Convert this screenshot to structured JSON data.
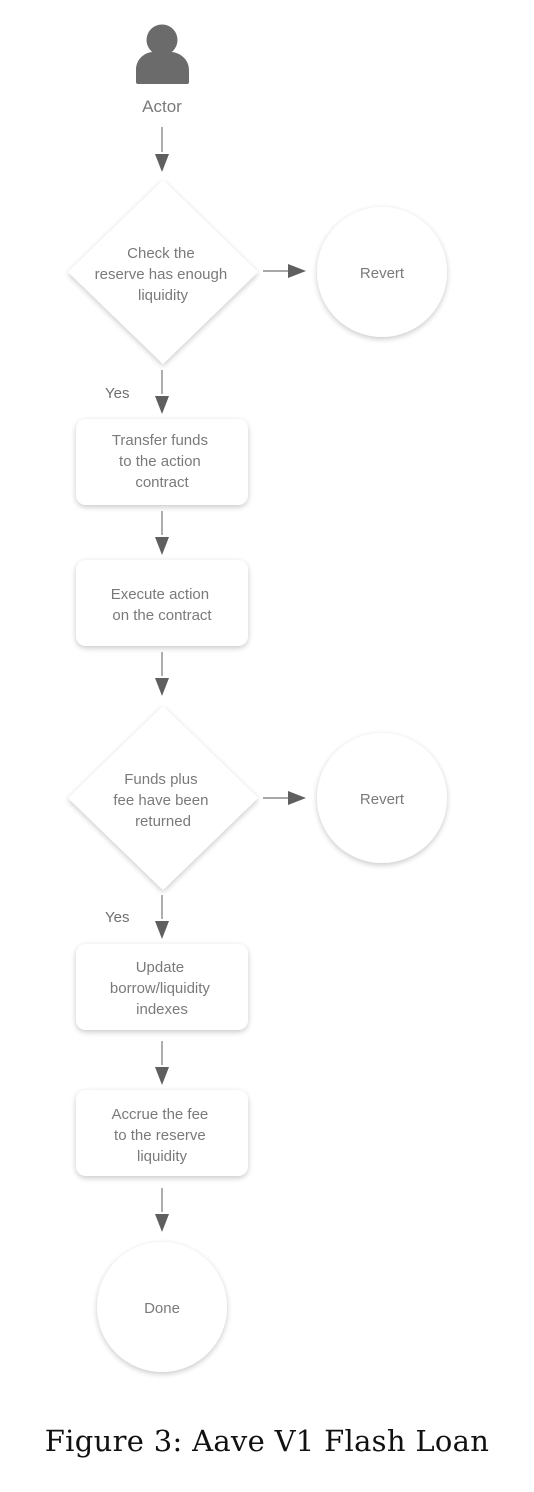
{
  "figure": {
    "caption": "Figure 3: Aave V1 Flash Loan",
    "colors": {
      "node_fill": "#ffffff",
      "text": "#7a7a7a",
      "icon": "#6b6b6b",
      "arrow_line": "#8c8c8c",
      "arrow_head": "#5f5f5f",
      "caption": "#111111"
    }
  },
  "actor": {
    "icon": "person-icon",
    "label": "Actor"
  },
  "nodes": {
    "check_liquidity": {
      "shape": "diamond",
      "lines": [
        "Check the",
        "reserve has enough",
        "liquidity"
      ]
    },
    "revert_1": {
      "shape": "circle",
      "lines": [
        "Revert"
      ]
    },
    "transfer_funds": {
      "shape": "rounded-rect",
      "lines": [
        "Transfer funds",
        "to the action",
        "contract"
      ]
    },
    "execute_action": {
      "shape": "rounded-rect",
      "lines": [
        "Execute action",
        "on the contract"
      ]
    },
    "funds_returned": {
      "shape": "diamond",
      "lines": [
        "Funds plus",
        "fee have been",
        "returned"
      ]
    },
    "revert_2": {
      "shape": "circle",
      "lines": [
        "Revert"
      ]
    },
    "update_indexes": {
      "shape": "rounded-rect",
      "lines": [
        "Update",
        "borrow/liquidity",
        "indexes"
      ]
    },
    "accrue_fee": {
      "shape": "rounded-rect",
      "lines": [
        "Accrue the fee",
        "to the reserve",
        "liquidity"
      ]
    },
    "done": {
      "shape": "circle",
      "lines": [
        "Done"
      ]
    }
  },
  "edges": [
    {
      "from": "actor",
      "to": "check_liquidity",
      "label": ""
    },
    {
      "from": "check_liquidity",
      "to": "revert_1",
      "label": ""
    },
    {
      "from": "check_liquidity",
      "to": "transfer_funds",
      "label": "Yes"
    },
    {
      "from": "transfer_funds",
      "to": "execute_action",
      "label": ""
    },
    {
      "from": "execute_action",
      "to": "funds_returned",
      "label": ""
    },
    {
      "from": "funds_returned",
      "to": "revert_2",
      "label": ""
    },
    {
      "from": "funds_returned",
      "to": "update_indexes",
      "label": "Yes"
    },
    {
      "from": "update_indexes",
      "to": "accrue_fee",
      "label": ""
    },
    {
      "from": "accrue_fee",
      "to": "done",
      "label": ""
    }
  ]
}
